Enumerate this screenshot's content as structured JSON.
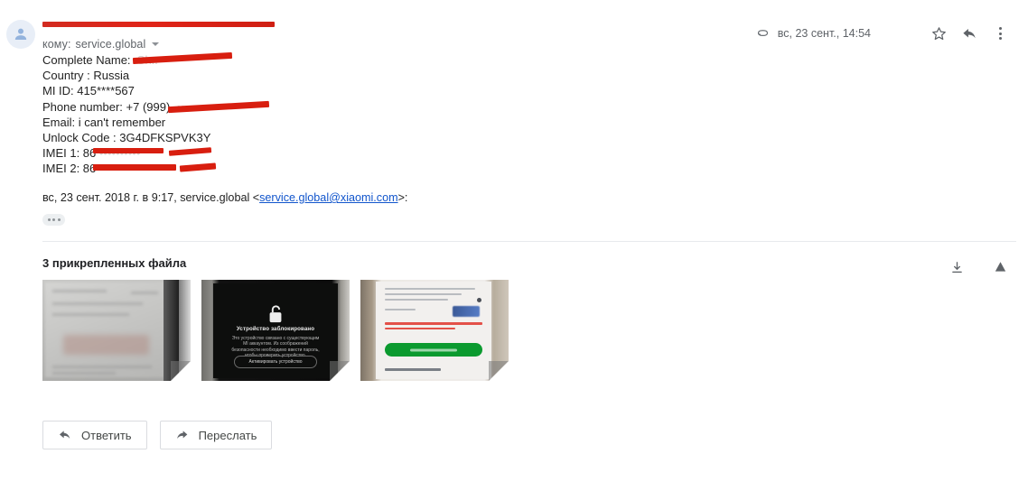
{
  "header": {
    "avatar_icon": "person-avatar-icon",
    "subject_redacted": true,
    "to_prefix": "кому:",
    "to_recipient": "service.global",
    "attachment_icon": "paperclip-icon",
    "date": "вс, 23 сент., 14:54",
    "star_icon": "star-icon",
    "reply_icon": "reply-arrow-icon",
    "more_icon": "more-vertical-icon"
  },
  "body": {
    "lines": [
      {
        "label": "Complete Name:",
        "value": "",
        "redacted": true
      },
      {
        "label": "Country : Russia",
        "value": "",
        "redacted": false
      },
      {
        "label": "MI ID:  415****567",
        "value": "",
        "redacted": false
      },
      {
        "label": "Phone number: +7 (999)",
        "value": "",
        "redacted": true
      },
      {
        "label": "Email: i can't remember",
        "value": "",
        "redacted": false
      },
      {
        "label": "Unlock Code :  3G4DFKSPVK3Y",
        "value": "",
        "redacted": false
      },
      {
        "label": "IMEI 1: 86",
        "value": "",
        "redacted": true
      },
      {
        "label": "IMEI 2: 86",
        "value": "",
        "redacted": true
      }
    ],
    "line_complete_name": "Complete Name:",
    "line_country": "Country : Russia",
    "line_miid": "MI ID:  415****567",
    "line_phone": "Phone number: +7 (999)",
    "line_email": "Email: i can't remember",
    "line_unlock": "Unlock Code :  3G4DFKSPVK3Y",
    "line_imei1": "IMEI 1: 86",
    "line_imei2": "IMEI 2: 86"
  },
  "quote": {
    "prefix": "вс, 23 сент. 2018 г. в 9:17, service.global <",
    "email_link": "service.global@xiaomi.com",
    "suffix": ">:",
    "expand_icon": "ellipsis-trimmed-content-icon"
  },
  "attachments": {
    "title": "3 прикрепленных файла",
    "download_icon": "download-icon",
    "drive_icon": "google-drive-icon",
    "items": [
      {
        "name": "attachment-thumbnail-1",
        "kind": "photo-blurred-document",
        "caption": ""
      },
      {
        "name": "attachment-thumbnail-2",
        "kind": "photo-locked-device-screen",
        "screen_title": "Устройство заблокировано",
        "screen_body": "Это устройство связано с существующим MI аккаунтом. Из соображений безопасности необходимо ввести пароль, чтобы проверить устройство.",
        "screen_button": "Активировать устройство"
      },
      {
        "name": "attachment-thumbnail-3",
        "kind": "photo-bank-app-error-screen",
        "caption": ""
      }
    ]
  },
  "footer": {
    "reply_label": "Ответить",
    "reply_icon": "reply-arrow-icon",
    "forward_label": "Переслать",
    "forward_icon": "forward-arrow-icon"
  },
  "colors": {
    "redaction_red": "#d81e0f",
    "link_blue": "#1155cc",
    "text": "#222222",
    "muted": "#5f6368",
    "divider": "#e8eaed",
    "green_button": "#0b9a2f"
  }
}
